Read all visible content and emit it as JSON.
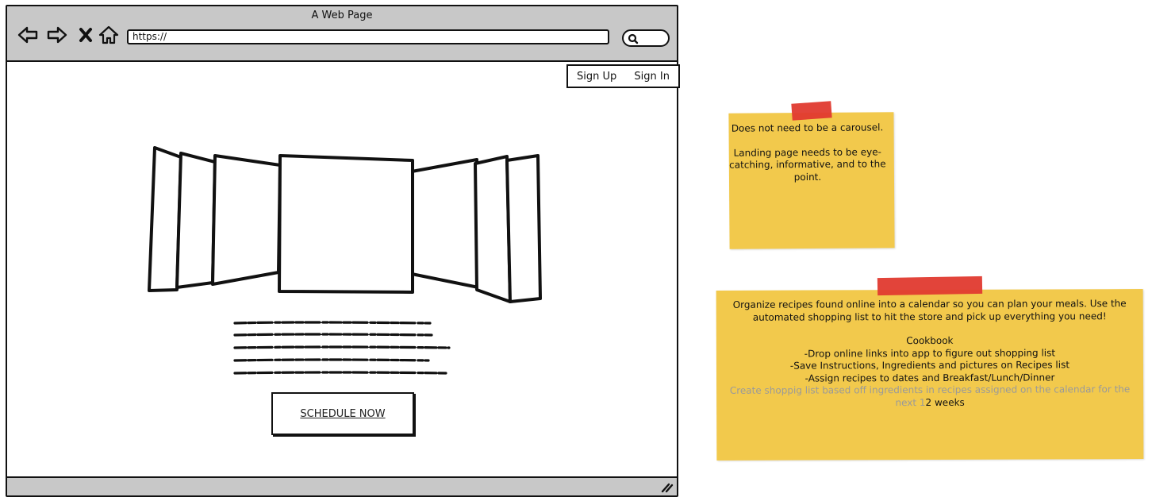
{
  "window": {
    "title": "A Web Page",
    "url_placeholder": "https://"
  },
  "icons": {
    "back": "arrow-left-icon",
    "forward": "arrow-right-icon",
    "stop": "close-icon",
    "home": "home-icon",
    "search": "search-icon",
    "resize": "resize-grip-icon"
  },
  "auth": {
    "sign_up": "Sign Up",
    "sign_in": "Sign In"
  },
  "hero": {
    "cta_label": "SCHEDULE NOW"
  },
  "notes": {
    "carousel_note": {
      "line1": "Does not need to be a carousel.",
      "line2": "Landing page needs to be eye-catching, informative, and to the point."
    },
    "app_note": {
      "intro": "Organize recipes found online into a calendar so you can plan your meals. Use the automated shopping list to hit the store and pick up everything you need!",
      "heading": "Cookbook",
      "item1": "-Drop online links into app to figure out shopping list",
      "item2": "-Save Instructions, Ingredients and pictures on Recipes list",
      "item3": "-Assign recipes to dates and Breakfast/Lunch/Dinner",
      "item4_faded": "Create shoppig list based off ingredients in recipes assigned on the calendar for the next 1",
      "item4_tail": "2 weeks"
    }
  },
  "colors": {
    "chrome": "#c8c8c8",
    "note": "#f2c94c",
    "tape": "#e03a2f",
    "stroke": "#111111"
  }
}
